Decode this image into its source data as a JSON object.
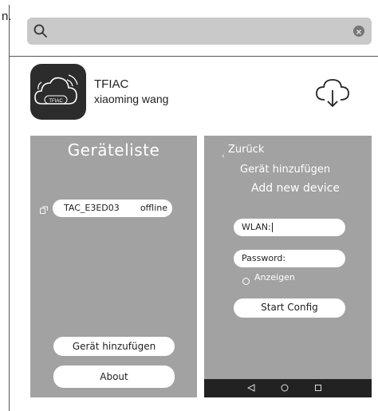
{
  "stray_text": "n.",
  "search": {
    "placeholder": "",
    "value": ""
  },
  "app": {
    "name": "TFIAC",
    "developer": "xiaoming wang",
    "icon_label": "TFIAC"
  },
  "left_panel": {
    "title": "Geräteliste",
    "device": {
      "name": "TAC_E3ED03",
      "status": "offline"
    },
    "add_device_label": "Gerät hinzufügen",
    "about_label": "About"
  },
  "right_panel": {
    "back_label": "Zurück",
    "back_chevron": "‹",
    "title_de": "Gerät hinzufügen",
    "title_en": "Add new device",
    "wlan_label": "WLAN:",
    "password_label": "Password:",
    "show_label": "Anzeigen",
    "start_label": "Start Config"
  },
  "icons": [
    "search-icon",
    "clear-icon",
    "app-icon",
    "cloud-download-icon",
    "device-icon",
    "nav-back-icon",
    "nav-home-icon",
    "nav-recent-icon"
  ]
}
